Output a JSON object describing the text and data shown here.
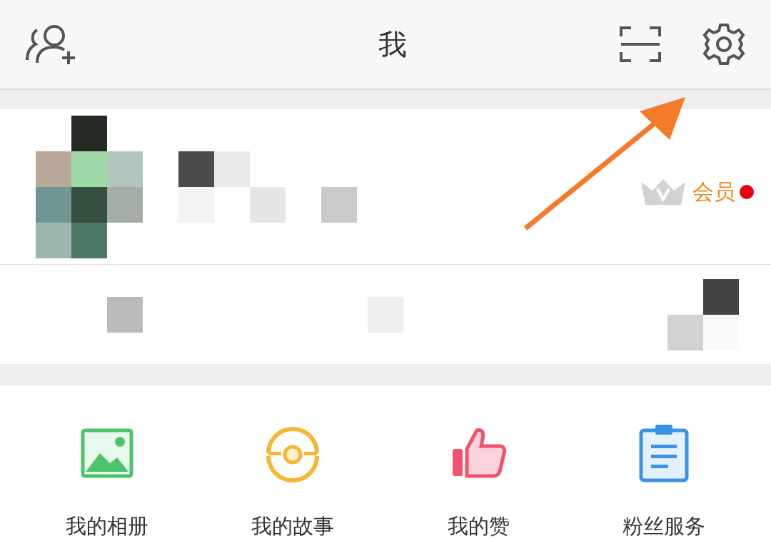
{
  "header": {
    "title": "我"
  },
  "profile": {
    "vip_label": "会员",
    "vip_unread": true
  },
  "shortcuts": [
    {
      "label": "我的相册",
      "kind": "album"
    },
    {
      "label": "我的故事",
      "kind": "story"
    },
    {
      "label": "我的赞",
      "kind": "like"
    },
    {
      "label": "粉丝服务",
      "kind": "fans"
    }
  ]
}
